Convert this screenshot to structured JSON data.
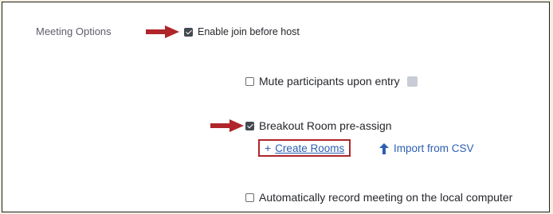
{
  "meeting_options": {
    "section_label": "Meeting Options",
    "enable_join_before_host": {
      "label": "Enable join before host",
      "checked": true
    },
    "mute_participants": {
      "label": "Mute participants upon entry",
      "checked": false
    },
    "breakout_room": {
      "label": "Breakout Room pre-assign",
      "checked": true
    },
    "create_rooms": {
      "label": "Create Rooms",
      "icon": "plus-icon"
    },
    "import_csv": {
      "label": "Import from CSV",
      "icon": "upload-arrow-icon"
    },
    "auto_record": {
      "label": "Automatically record meeting on the local computer",
      "checked": false
    }
  },
  "colors": {
    "annotation_red": "#b0252a",
    "link_blue": "#2d5fb4",
    "background": "#f3f0e2"
  }
}
